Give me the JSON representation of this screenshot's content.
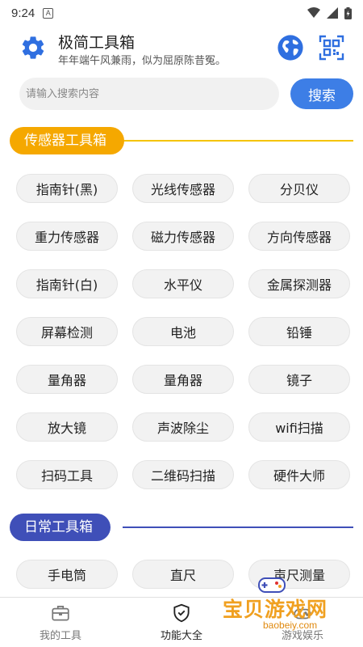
{
  "status": {
    "time": "9:24",
    "notification_glyph": "A"
  },
  "header": {
    "title": "极简工具箱",
    "subtitle": "年年端午风兼雨，似为屈原陈昔冤。"
  },
  "search": {
    "placeholder": "请输入搜索内容",
    "button_label": "搜索"
  },
  "sections": [
    {
      "title": "传感器工具箱",
      "color": "#f5a800",
      "tools": [
        "指南针(黑)",
        "光线传感器",
        "分贝仪",
        "重力传感器",
        "磁力传感器",
        "方向传感器",
        "指南针(白)",
        "水平仪",
        "金属探测器",
        "屏幕检测",
        "电池",
        "铅锤",
        "量角器",
        "量角器",
        "镜子",
        "放大镜",
        "声波除尘",
        "wifi扫描",
        "扫码工具",
        "二维码扫描",
        "硬件大师"
      ]
    },
    {
      "title": "日常工具箱",
      "color": "#3f4fb8",
      "tools": [
        "手电筒",
        "直尺",
        "声尺测量"
      ]
    }
  ],
  "bottom_nav": [
    {
      "label": "我的工具",
      "icon": "briefcase-icon",
      "active": false
    },
    {
      "label": "功能大全",
      "icon": "shield-check-icon",
      "active": true
    },
    {
      "label": "游戏娱乐",
      "icon": "gamepad-icon",
      "active": false
    }
  ],
  "watermark": {
    "title": "宝贝游戏网",
    "url": "baobeiy.com"
  },
  "colors": {
    "accent": "#3d7ee6",
    "sensor": "#f5a800",
    "daily": "#3f4fb8"
  }
}
